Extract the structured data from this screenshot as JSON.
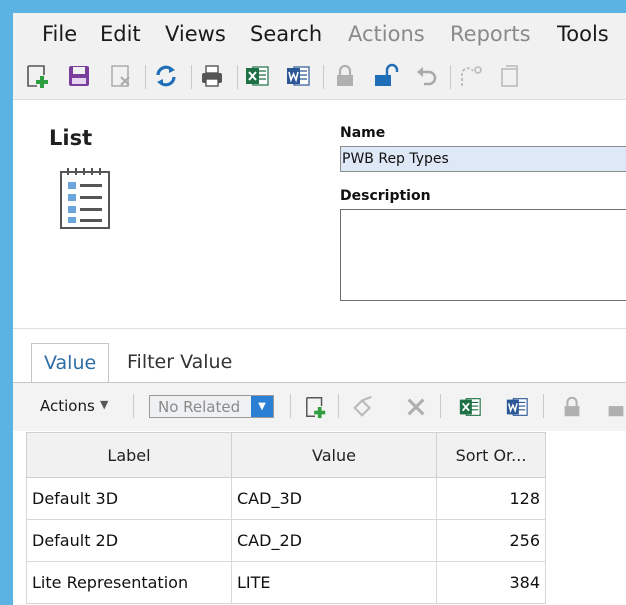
{
  "menu": {
    "file": "File",
    "edit": "Edit",
    "views": "Views",
    "search": "Search",
    "actions": "Actions",
    "reports": "Reports",
    "tools": "Tools"
  },
  "toolbar_icons": [
    "new-icon",
    "save-icon",
    "delete-icon",
    "refresh-icon",
    "print-icon",
    "excel-icon",
    "word-icon",
    "lock-icon",
    "unlock-icon",
    "undo-icon",
    "redo-icon",
    "copy-icon"
  ],
  "form": {
    "list_title": "List",
    "name_label": "Name",
    "name_value": "PWB Rep Types",
    "description_label": "Description",
    "description_value": ""
  },
  "tabs": [
    {
      "label": "Value",
      "active": true
    },
    {
      "label": "Filter Value",
      "active": false
    }
  ],
  "grid_toolbar": {
    "actions_label": "Actions",
    "related_value": "No Related"
  },
  "table": {
    "columns": [
      "Label",
      "Value",
      "Sort Or..."
    ],
    "rows": [
      [
        "Default 3D",
        "CAD_3D",
        "128"
      ],
      [
        "Default 2D",
        "CAD_2D",
        "256"
      ],
      [
        "Lite Representation",
        "LITE",
        "384"
      ]
    ]
  },
  "colors": {
    "window_frame": "#5ab3e2",
    "name_field_bg": "#dfe8f6",
    "active_tab_text": "#2e6ea6",
    "combo_button": "#2b7fd4",
    "excel_green": "#1e7145",
    "word_blue": "#2b5797",
    "save_purple": "#7a3e9d",
    "new_green": "#2f9e3f",
    "refresh_blue": "#1f6fb8"
  }
}
